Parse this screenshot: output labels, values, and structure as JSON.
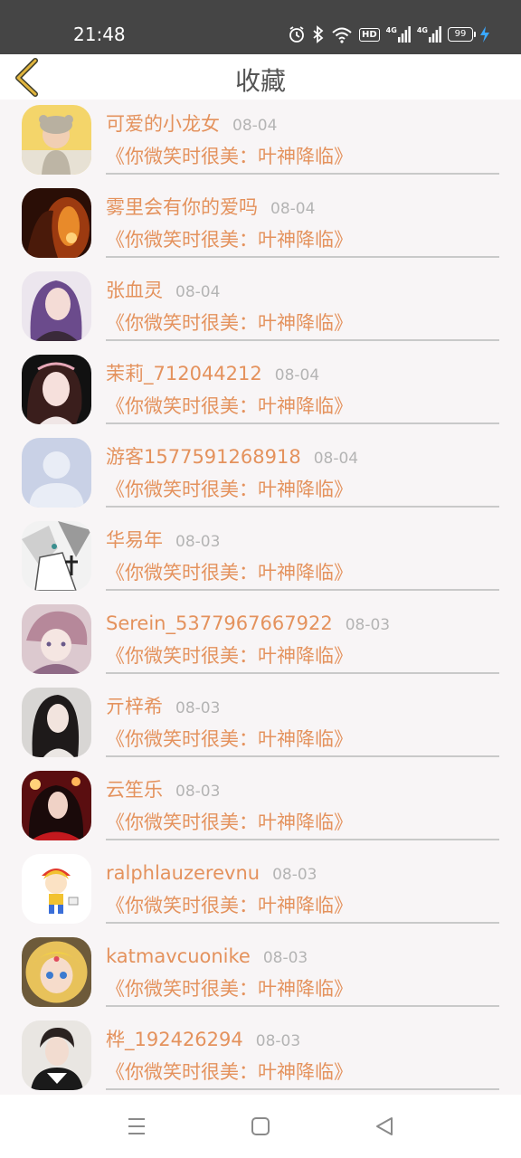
{
  "status_bar": {
    "time": "21:48",
    "hd_badge": "HD",
    "network_1": "4G",
    "network_2": "4G",
    "battery_level": "99",
    "icons": [
      "alarm-icon",
      "bluetooth-icon",
      "wifi-icon",
      "hd-icon",
      "signal-icon",
      "signal-icon",
      "battery-icon",
      "charging-icon"
    ]
  },
  "header": {
    "title": "收藏",
    "back_icon": "chevron-left-icon",
    "accent_color": "#e4925d"
  },
  "favorites": [
    {
      "name": "可爱的小龙女",
      "date": "08-04",
      "book": "《你微笑时很美：叶神降临》"
    },
    {
      "name": "雾里会有你的爱吗",
      "date": "08-04",
      "book": "《你微笑时很美：叶神降临》"
    },
    {
      "name": "张血灵",
      "date": "08-04",
      "book": "《你微笑时很美：叶神降临》"
    },
    {
      "name": "茉莉_712044212",
      "date": "08-04",
      "book": "《你微笑时很美：叶神降临》"
    },
    {
      "name": "游客1577591268918",
      "date": "08-04",
      "book": "《你微笑时很美：叶神降临》"
    },
    {
      "name": "华易年",
      "date": "08-03",
      "book": "《你微笑时很美：叶神降临》"
    },
    {
      "name": "Serein_5377967667922",
      "date": "08-03",
      "book": "《你微笑时很美：叶神降临》"
    },
    {
      "name": "亓梓希",
      "date": "08-03",
      "book": "《你微笑时很美：叶神降临》"
    },
    {
      "name": "云笙乐",
      "date": "08-03",
      "book": "《你微笑时很美：叶神降临》"
    },
    {
      "name": "ralphlauzerevnu",
      "date": "08-03",
      "book": "《你微笑时很美：叶神降临》"
    },
    {
      "name": "katmavcuonike",
      "date": "08-03",
      "book": "《你微笑时很美：叶神降临》"
    },
    {
      "name": "桦_192426294",
      "date": "08-03",
      "book": "《你微笑时很美：叶神降临》"
    }
  ],
  "nav_bar": {
    "icons": [
      "menu-icon",
      "home-square-icon",
      "back-triangle-icon"
    ]
  }
}
